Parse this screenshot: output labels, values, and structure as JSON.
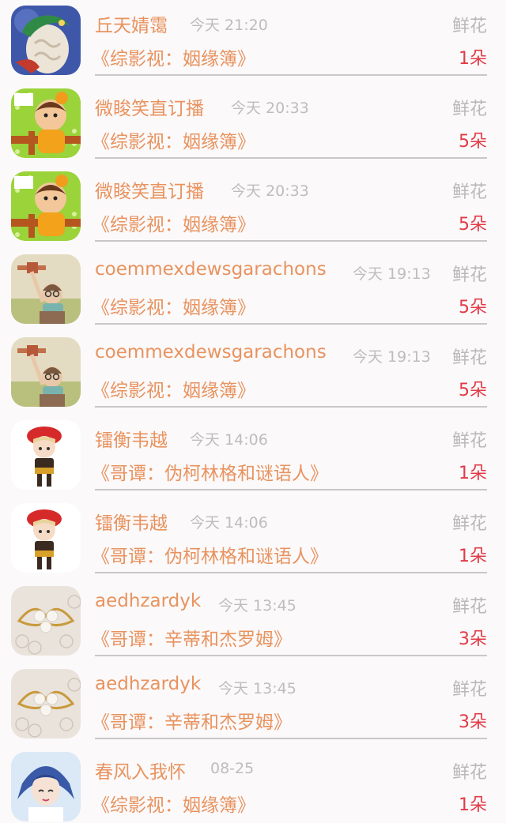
{
  "gift_records": [
    {
      "name": "丘天婧霭",
      "time": "今天 21:20",
      "gift": "鲜花",
      "book": "《综影视：姻缘簿》",
      "count": "1朵",
      "avatar": "dragon-egg-avatar"
    },
    {
      "name": "微睃笑直订播",
      "time": "今天 20:33",
      "gift": "鲜花",
      "book": "《综影视：姻缘簿》",
      "count": "5朵",
      "avatar": "cartoon-girl-avatar"
    },
    {
      "name": "微睃笑直订播",
      "time": "今天 20:33",
      "gift": "鲜花",
      "book": "《综影视：姻缘簿》",
      "count": "5朵",
      "avatar": "cartoon-girl-avatar"
    },
    {
      "name": "coemmexdewsgarachons",
      "time": "今天 19:13",
      "gift": "鲜花",
      "book": "《综影视：姻缘簿》",
      "count": "5朵",
      "avatar": "pilot-plane-avatar"
    },
    {
      "name": "coemmexdewsgarachons",
      "time": "今天 19:13",
      "gift": "鲜花",
      "book": "《综影视：姻缘簿》",
      "count": "5朵",
      "avatar": "pilot-plane-avatar"
    },
    {
      "name": "镭衡韦越",
      "time": "今天 14:06",
      "gift": "鲜花",
      "book": "《哥谭：伪柯林格和谜语人》",
      "count": "1朵",
      "avatar": "red-beret-boy-avatar"
    },
    {
      "name": "镭衡韦越",
      "time": "今天 14:06",
      "gift": "鲜花",
      "book": "《哥谭：伪柯林格和谜语人》",
      "count": "1朵",
      "avatar": "red-beret-boy-avatar"
    },
    {
      "name": "aedhzardyk",
      "time": "今天 13:45",
      "gift": "鲜花",
      "book": "《哥谭：辛蒂和杰罗姆》",
      "count": "3朵",
      "avatar": "pearl-bow-avatar"
    },
    {
      "name": "aedhzardyk",
      "time": "今天 13:45",
      "gift": "鲜花",
      "book": "《哥谭：辛蒂和杰罗姆》",
      "count": "3朵",
      "avatar": "pearl-bow-avatar"
    },
    {
      "name": "春风入我怀",
      "time": "08-25",
      "gift": "鲜花",
      "book": "《综影视：姻缘簿》",
      "count": "1朵",
      "avatar": "anime-boy-avatar"
    }
  ],
  "colors": {
    "name": "#e8935f",
    "book": "#e8935f",
    "count": "#e23a46",
    "muted": "#b9b9b9",
    "background": "#fbf9fa"
  }
}
